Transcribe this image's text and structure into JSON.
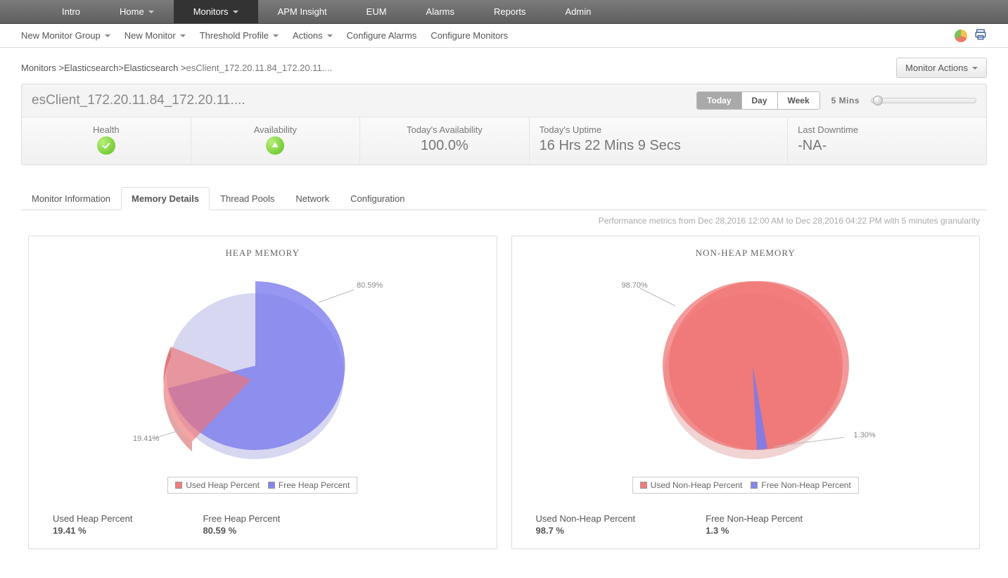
{
  "topnav": {
    "items": [
      {
        "label": "Intro",
        "caret": false
      },
      {
        "label": "Home",
        "caret": true
      },
      {
        "label": "Monitors",
        "caret": true,
        "active": true
      },
      {
        "label": "APM Insight",
        "caret": false
      },
      {
        "label": "EUM",
        "caret": false
      },
      {
        "label": "Alarms",
        "caret": false
      },
      {
        "label": "Reports",
        "caret": false
      },
      {
        "label": "Admin",
        "caret": false
      }
    ]
  },
  "subnav": {
    "items": [
      {
        "label": "New Monitor Group",
        "caret": true
      },
      {
        "label": "New Monitor",
        "caret": true
      },
      {
        "label": "Threshold Profile",
        "caret": true
      },
      {
        "label": "Actions",
        "caret": true
      },
      {
        "label": "Configure Alarms",
        "caret": false
      },
      {
        "label": "Configure Monitors",
        "caret": false
      }
    ]
  },
  "breadcrumb": {
    "parts": [
      "Monitors",
      "Elasticsearch",
      "Elasticsearch"
    ],
    "current": "esClient_172.20.11.84_172.20.11...."
  },
  "monitor_actions_label": "Monitor Actions",
  "titlebar": {
    "title": "esClient_172.20.11.84_172.20.11....",
    "segments": [
      {
        "label": "Today",
        "active": true
      },
      {
        "label": "Day",
        "active": false
      },
      {
        "label": "Week",
        "active": false
      }
    ],
    "interval": "5 Mins"
  },
  "status": {
    "health_label": "Health",
    "availability_label": "Availability",
    "today_avail_label": "Today's Availability",
    "today_avail_value": "100.0%",
    "today_uptime_label": "Today's Uptime",
    "today_uptime_value": "16 Hrs 22 Mins 9 Secs",
    "last_downtime_label": "Last Downtime",
    "last_downtime_value": "-NA-"
  },
  "tabs": {
    "items": [
      {
        "label": "Monitor Information"
      },
      {
        "label": "Memory Details",
        "active": true
      },
      {
        "label": "Thread Pools"
      },
      {
        "label": "Network"
      },
      {
        "label": "Configuration"
      }
    ]
  },
  "metrics_note": "Performance metrics from Dec 28,2016 12:00 AM to Dec 28,2016 04:22 PM with 5 minutes granularity",
  "charts": {
    "heap": {
      "title": "HEAP MEMORY",
      "used_label": "Used Heap Percent",
      "free_label": "Free Heap Percent",
      "used_pct_text": "19.41%",
      "free_pct_text": "80.59%",
      "summary_used_label": "Used Heap Percent",
      "summary_used_val": "19.41 %",
      "summary_free_label": "Free Heap Percent",
      "summary_free_val": "80.59 %"
    },
    "nonheap": {
      "title": "NON-HEAP MEMORY",
      "used_label": "Used Non-Heap Percent",
      "free_label": "Free Non-Heap Percent",
      "used_pct_text": "98.70%",
      "free_pct_text": "1.30%",
      "summary_used_label": "Used Non-Heap Percent",
      "summary_used_val": "98.7 %",
      "summary_free_label": "Free Non-Heap Percent",
      "summary_free_val": "1.3 %"
    }
  },
  "chart_data": [
    {
      "type": "pie",
      "title": "HEAP MEMORY",
      "series": [
        {
          "name": "Used Heap Percent",
          "value": 19.41,
          "color": "#f07272"
        },
        {
          "name": "Free Heap Percent",
          "value": 80.59,
          "color": "#7a7aee"
        }
      ]
    },
    {
      "type": "pie",
      "title": "NON-HEAP MEMORY",
      "series": [
        {
          "name": "Used Non-Heap Percent",
          "value": 98.7,
          "color": "#f07272"
        },
        {
          "name": "Free Non-Heap Percent",
          "value": 1.3,
          "color": "#7a7aee"
        }
      ]
    }
  ]
}
